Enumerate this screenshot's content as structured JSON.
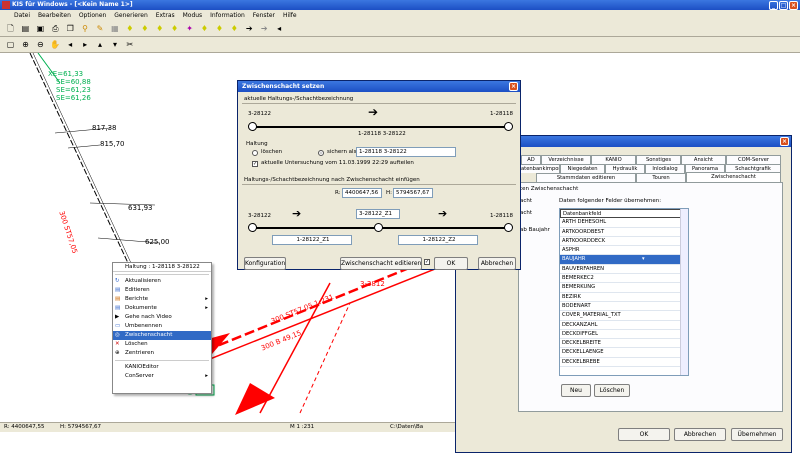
{
  "main": {
    "title": "KIS für Windows - [<Kein Name 1>]",
    "menu": [
      "Datei",
      "Bearbeiten",
      "Optionen",
      "Generieren",
      "Extras",
      "Modus",
      "Information",
      "Fenster",
      "Hilfe"
    ],
    "status": {
      "x": "R: 4400647,55",
      "y": "H: 5794567,67",
      "scale": "M 1 :231",
      "path": "C:\\Daten\\Ba"
    }
  },
  "map_labels": {
    "a1": "XE=61,33",
    "a2": "SE=60,88",
    "a3": "SE=61,23",
    "a4": "SE=61,26",
    "b1": "817,38",
    "b2": "815,70",
    "c1": "631,93",
    "c2": "625,00",
    "d1": "300 ST57,05",
    "d2": "300 ST57,05 1:231",
    "d3": "300 B 49,15",
    "d4": "3-2812"
  },
  "context_menu": {
    "header": "Haltung : 1-28118 3-28122",
    "items": [
      "Aktualisieren",
      "Editieren",
      "Berichte",
      "Dokumente",
      "Gehe nach Video",
      "Umbenennen",
      "Zwischenschacht",
      "Löschen",
      "Zentrieren",
      "KANIOEditor",
      "ConServer"
    ],
    "selected_index": 6
  },
  "dialog1": {
    "title": "Zwischenschacht setzen",
    "group1_label": "aktuelle Haltungs-/Schachtbezeichnung",
    "left_node": "3-28122",
    "right_node": "1-28118",
    "line_label": "1-28118 3-28122",
    "haltung_label": "Haltung",
    "radio_loeschen": "löschen",
    "radio_sichern": "sichern als",
    "sichern_value": "1-28118 3-28122",
    "checkbox_label": "aktuelle Untersuchung vom 11.03.1999 22:29 aufteilen",
    "group2_label": "Haltungs-/Schachtbezeichnung nach Zwischenschacht einfügen",
    "r_label": "R:",
    "r_value": "4400647,56",
    "h_label": "H:",
    "h_value": "5794567,67",
    "node_left": "3-28122",
    "node_mid": "3-28122_Z1",
    "node_right": "1-28118",
    "seg_left": "1-28122_Z1",
    "seg_right": "1-28122_Z2",
    "btn_config": "Konfiguration",
    "chk_edit": "Zwischenschacht editieren",
    "btn_ok": "OK",
    "btn_cancel": "Abbrechen"
  },
  "dialog2": {
    "tabs_row1": [
      "AD",
      "Verzeichnisse",
      "KANIO",
      "Sonstiges",
      "Ansicht",
      "COM-Server"
    ],
    "tabs_row2": [
      "Datenbankimport",
      "Niegedaten",
      "Hydraulik",
      "Inlodialog",
      "Panorama",
      "Schachtgrafik"
    ],
    "tabs_row3": [
      "Stammdaten editieren",
      "Touren",
      "Zwischenschacht"
    ],
    "group_label": "ten Zwischenschacht",
    "side1": "acht",
    "side2": "acht",
    "side3": "ab Baujahr",
    "list_label": "Daten folgender Felder übernehmen:",
    "list": [
      "Datenbankfeld",
      "ARTH DEHESOHL",
      "ARTKOORDBEST",
      "ARTKOORDDECK",
      "ASPHR",
      "BAUJAHR",
      "BAUVERFAHREN",
      "BEMERKEC2",
      "BEMERKUNG",
      "BEZIRK",
      "BODENART",
      "COVER_MATERIAL_TXT",
      "DECKANZAHL",
      "DECKDIFFGEL",
      "DECKELBREITE",
      "DECKELLAENGE",
      "DECKELBREBE"
    ],
    "selected_index": 5,
    "btn_neu": "Neu",
    "btn_loeschen": "Löschen",
    "btn_ok": "OK",
    "btn_cancel": "Abbrechen",
    "btn_apply": "Übernehmen"
  },
  "colors": {
    "titlebar": "#1c4fc4",
    "pipe_red": "#ff0000",
    "pipe_green": "#00b050",
    "selection": "#316ac5"
  }
}
